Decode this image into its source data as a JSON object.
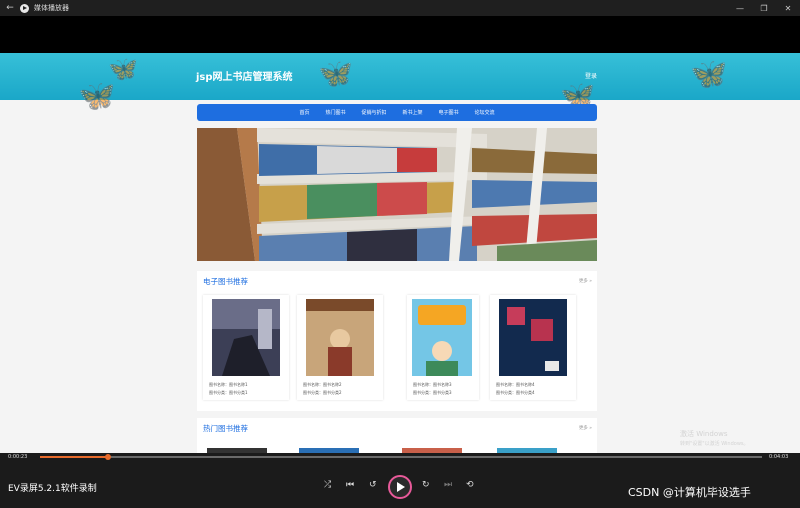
{
  "window": {
    "title": "媒体播放器"
  },
  "page": {
    "site_title": "jsp网上书店管理系统",
    "login_label": "登录",
    "nav": [
      "首页",
      "热门图书",
      "促销与折扣",
      "新书上架",
      "电子图书",
      "论坛交流"
    ],
    "sections": [
      {
        "title": "电子图书推荐",
        "more": "更多 »",
        "books": [
          {
            "name_line": "图书名称：图书名称1",
            "cat_line": "图书分类：图书分类1",
            "cover_color": "#3c3f56",
            "cover_text": "MANOUR SOCIETE TATLONIE"
          },
          {
            "name_line": "图书名称：图书名称2",
            "cat_line": "图书分类：图书分类2",
            "cover_color": "#c8a57a",
            "cover_text": "Sarah, Plain and Tall"
          },
          {
            "name_line": "图书名称：图书名称3",
            "cat_line": "图书分类：图书分类3",
            "cover_color": "#74c6e6",
            "cover_text": "书韵飘香 悦读人生"
          },
          {
            "name_line": "图书名称：图书名称4",
            "cat_line": "图书分类：图书分类4",
            "cover_color": "#122a4e",
            "cover_text": "古董局中局"
          }
        ]
      },
      {
        "title": "热门图书推荐",
        "more": "更多 »"
      }
    ]
  },
  "windows_notice": {
    "line1": "激活 Windows",
    "line2": "转到\"设置\"以激活 Windows。"
  },
  "player": {
    "current_time": "0:00:23",
    "total_time": "0:04:03",
    "progress": 0.094,
    "accent_color": "#e86b2c"
  },
  "watermarks": {
    "left": "EV录屏5.2.1软件录制",
    "right": "CSDN @计算机毕设选手"
  }
}
